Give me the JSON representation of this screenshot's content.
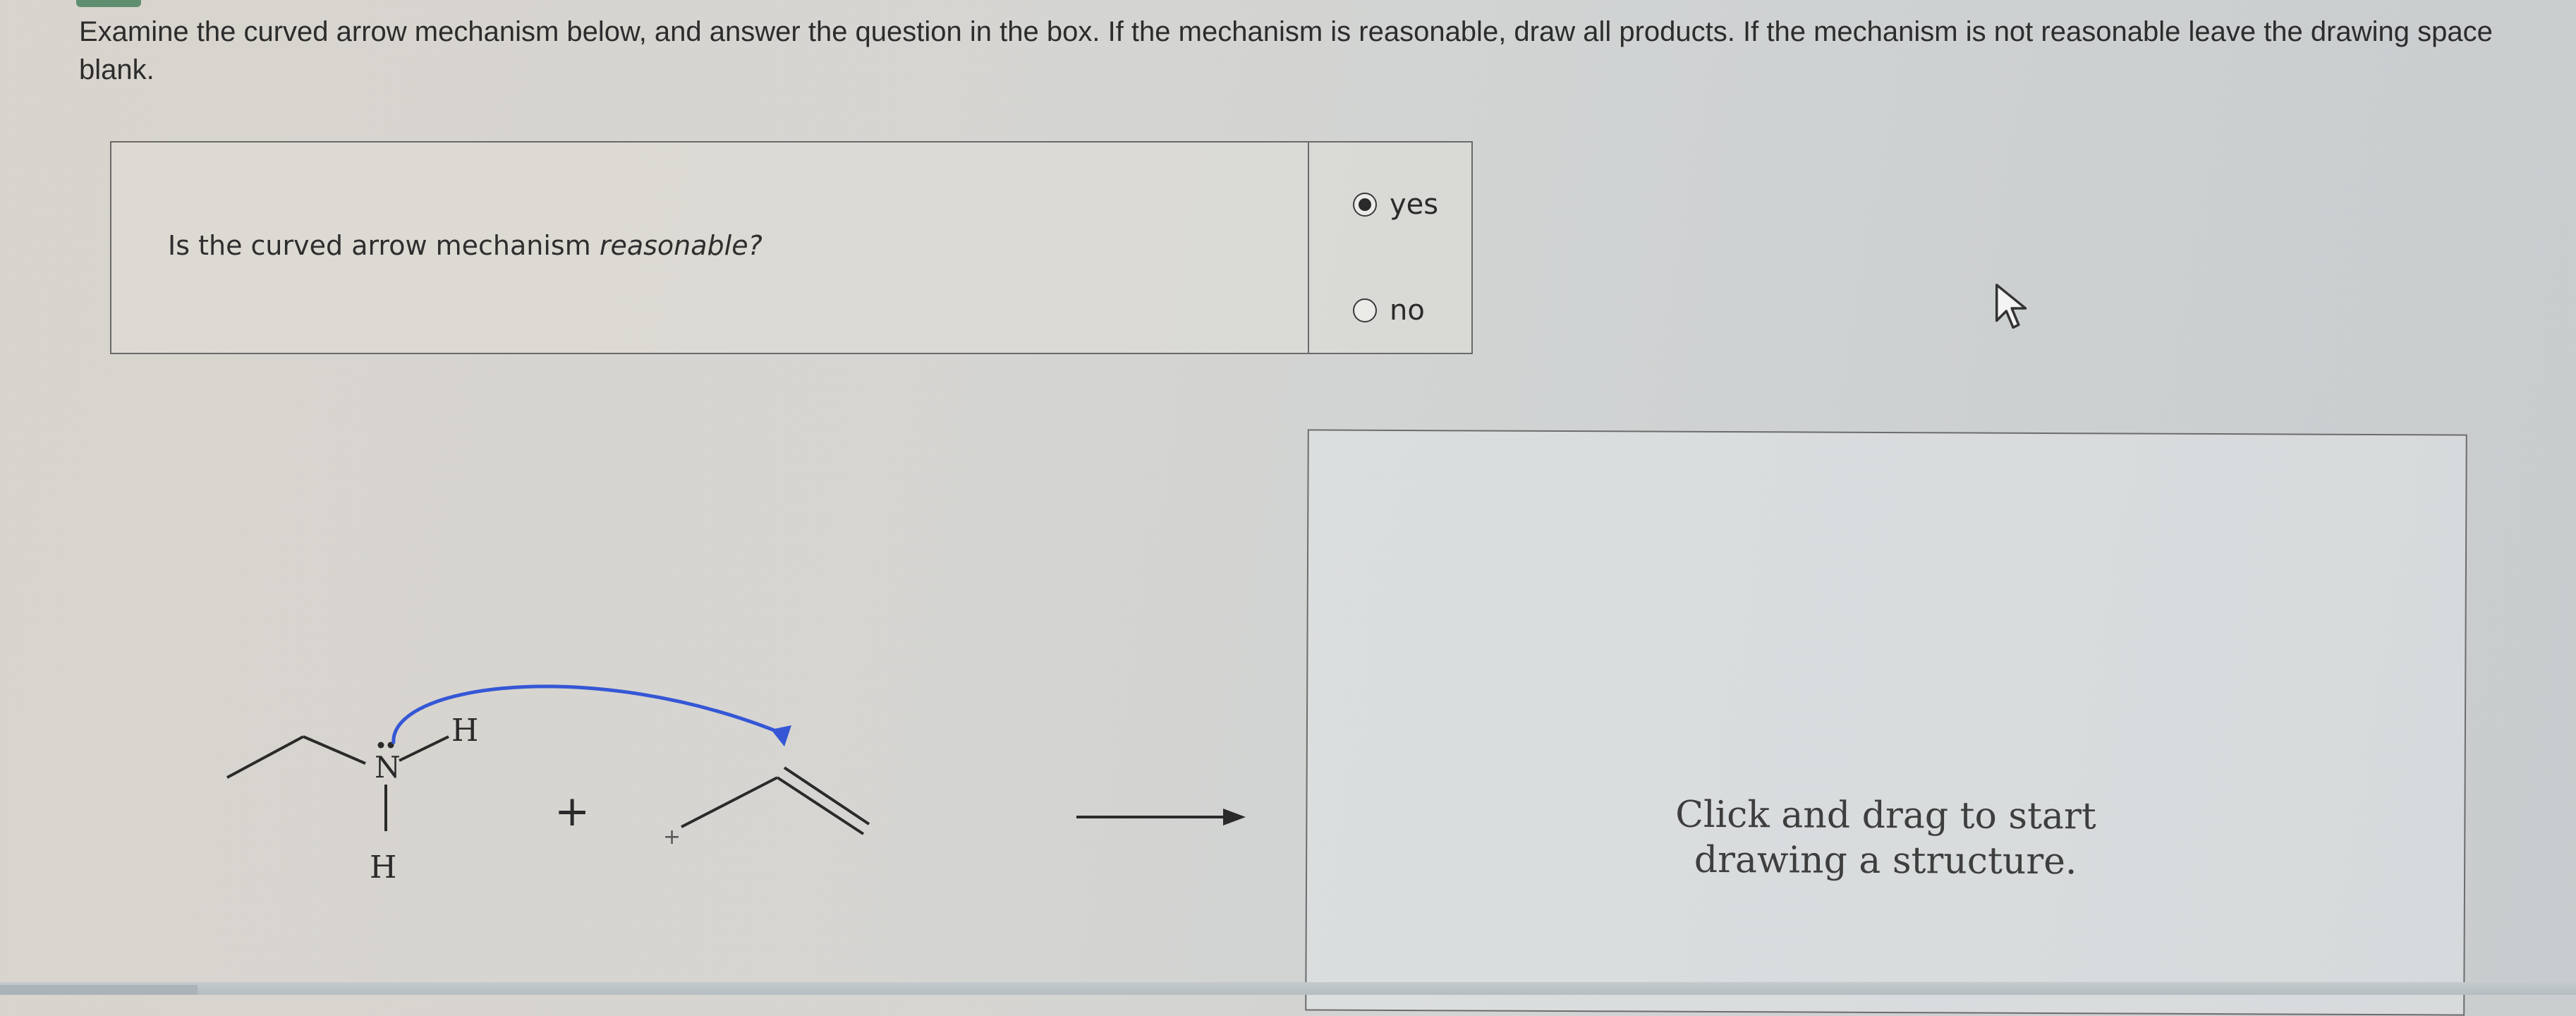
{
  "instructions": "Examine the curved arrow mechanism below, and answer the question in the box. If the mechanism is reasonable, draw all products. If the mechanism is not reasonable leave the drawing space blank.",
  "question": {
    "text_main": "Is the curved arrow mechanism ",
    "text_emphasis": "reasonable?"
  },
  "options": [
    {
      "label": "yes",
      "selected": true
    },
    {
      "label": "no",
      "selected": false
    }
  ],
  "scheme": {
    "nitrogen_label": "N",
    "hydrogen_top": "H",
    "hydrogen_bottom": "H",
    "plus_large": "+",
    "plus_charge": "+"
  },
  "draw_panel": {
    "hint": "Click and drag to start drawing a structure."
  },
  "colors": {
    "arrow_blue": "#3557d6",
    "text_dark": "#2b2b2b"
  }
}
